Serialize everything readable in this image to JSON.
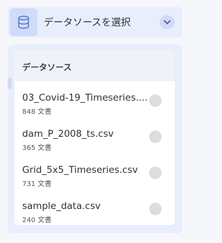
{
  "selector": {
    "label": "データソースを選択",
    "icon": "database-icon",
    "chevron_icon": "chevron-down-icon"
  },
  "dropdown": {
    "header": "データソース",
    "items": [
      {
        "name": "03_Covid-19_Timeseries....",
        "count": "848 文書"
      },
      {
        "name": "dam_P_2008_ts.csv",
        "count": "365 文書"
      },
      {
        "name": "Grid_5x5_Timeseries.csv",
        "count": "731 文書"
      },
      {
        "name": "sample_data.csv",
        "count": "240 文書"
      }
    ]
  },
  "colors": {
    "accent": "#5b7fd6",
    "accent_bg": "#cfdbf8",
    "panel_bg": "#e8eefc"
  }
}
